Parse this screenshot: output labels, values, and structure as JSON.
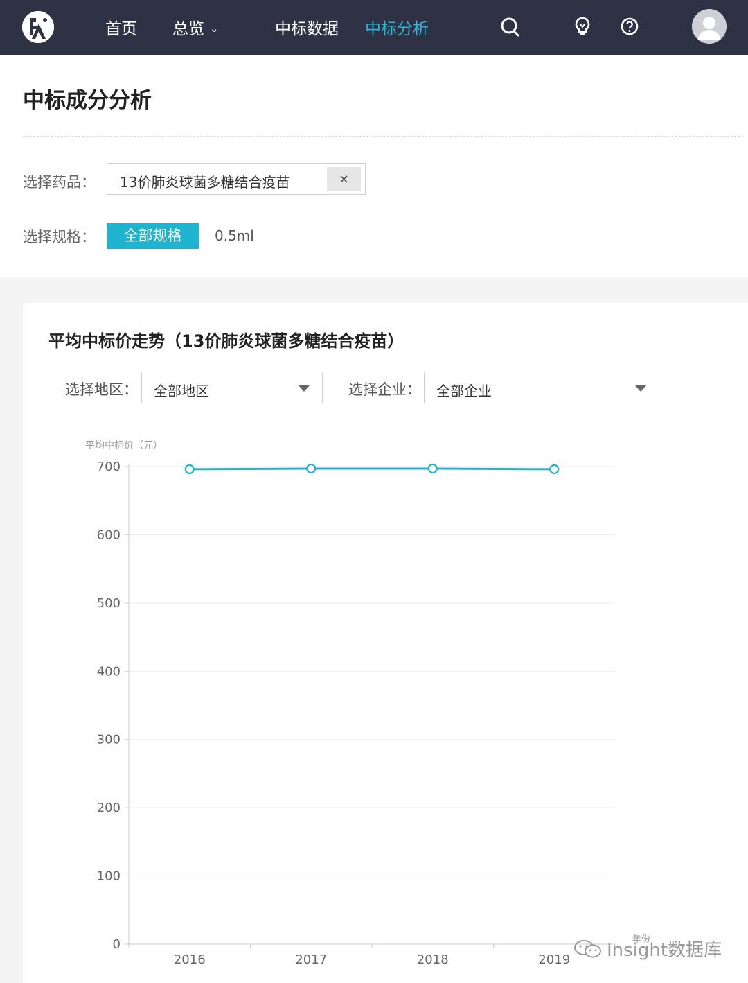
{
  "nav": {
    "items": [
      {
        "label": "首页",
        "active": false
      },
      {
        "label": "总览",
        "active": false,
        "has_dropdown": true
      },
      {
        "label": "中标数据",
        "active": false
      },
      {
        "label": "中标分析",
        "active": true
      }
    ],
    "icons": [
      "search-icon",
      "bulb-icon",
      "help-icon"
    ],
    "accent_color": "#2bb5d6",
    "background_color": "#2f3145"
  },
  "page": {
    "title": "中标成分分析"
  },
  "filters": {
    "drug_label": "选择药品：",
    "drug_value": "13价肺炎球菌多糖结合疫苗",
    "clear_symbol": "×",
    "spec_label": "选择规格：",
    "spec_selected": "全部规格",
    "spec_option": "0.5ml"
  },
  "card": {
    "title": "平均中标价走势（13价肺炎球菌多糖结合疫苗）",
    "region_label": "选择地区：",
    "region_value": "全部地区",
    "company_label": "选择企业：",
    "company_value": "全部企业"
  },
  "chart_data": {
    "type": "line",
    "title": "",
    "ylabel": "平均中标价（元）",
    "xlabel": "年份",
    "categories": [
      "2016",
      "2017",
      "2018",
      "2019"
    ],
    "series": [
      {
        "values": [
          696,
          697,
          697,
          696
        ],
        "color": "#1eb3cf"
      }
    ],
    "ylim": [
      0,
      700
    ],
    "yticks": [
      0,
      100,
      200,
      300,
      400,
      500,
      600,
      700
    ],
    "grid": true
  },
  "watermark": {
    "text": "Insight数据库"
  }
}
